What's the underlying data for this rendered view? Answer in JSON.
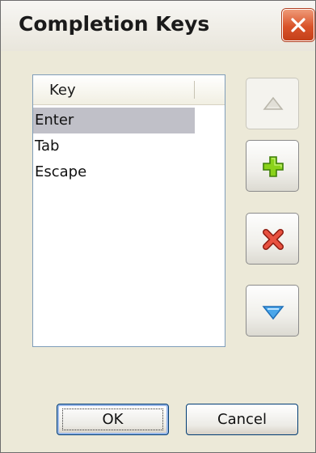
{
  "dialog": {
    "title": "Completion Keys",
    "close_icon": "close-icon"
  },
  "keys_list": {
    "column_header": "Key",
    "items": [
      {
        "label": "Enter",
        "selected": true
      },
      {
        "label": "Tab",
        "selected": false
      },
      {
        "label": "Escape",
        "selected": false
      }
    ]
  },
  "side_buttons": [
    {
      "icon": "move-up-icon",
      "enabled": false
    },
    {
      "icon": "add-icon",
      "enabled": true
    },
    {
      "icon": "delete-icon",
      "enabled": true
    },
    {
      "icon": "move-down-icon",
      "enabled": true
    }
  ],
  "footer": {
    "ok_label": "OK",
    "cancel_label": "Cancel"
  },
  "colors": {
    "selection": "#c0c0c8",
    "add_icon": "#8ad21a",
    "delete_icon": "#d83a2a",
    "move_down_icon": "#3f9be3",
    "close_button": "#d9532a"
  }
}
